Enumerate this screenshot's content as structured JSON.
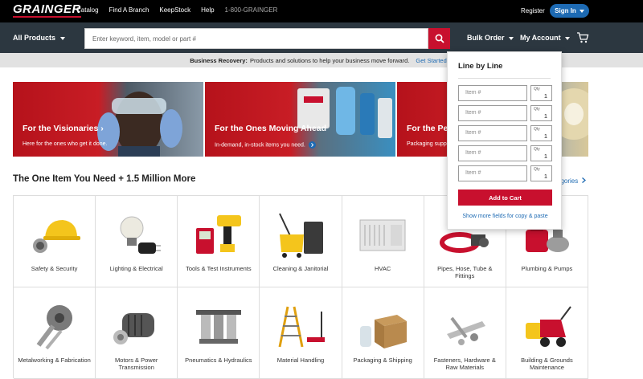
{
  "topbar": {
    "logo": "GRAINGER",
    "links": [
      "Catalog",
      "Find A Branch",
      "KeepStock",
      "Help"
    ],
    "phone": "1-800-GRAINGER",
    "register": "Register",
    "signin": "Sign In"
  },
  "navbar": {
    "all_products": "All Products",
    "search_placeholder": "Enter keyword, item, model or part #",
    "bulk_order": "Bulk Order",
    "my_account": "My Account"
  },
  "banner": {
    "bold": "Business Recovery:",
    "text": "Products and solutions to help your business move forward.",
    "link": "Get Started"
  },
  "heroes": [
    {
      "title": "For the Visionaries",
      "sub": "Here for the ones who get it done."
    },
    {
      "title": "For the Ones Moving Ahead",
      "sub": "In-demand, in-stock items you need."
    },
    {
      "title": "For the Pe",
      "sub": "Packaging supp"
    }
  ],
  "section": {
    "title": "The One Item You Need + 1.5 Million More",
    "all_categories": "egories"
  },
  "categories": [
    {
      "label": "Safety & Security",
      "icon": "hard-hat"
    },
    {
      "label": "Lighting & Electrical",
      "icon": "bulb"
    },
    {
      "label": "Tools & Test Instruments",
      "icon": "drill"
    },
    {
      "label": "Cleaning & Janitorial",
      "icon": "mop-bucket"
    },
    {
      "label": "HVAC",
      "icon": "ac-unit"
    },
    {
      "label": "Pipes, Hose, Tube & Fittings",
      "icon": "hose"
    },
    {
      "label": "Plumbing & Pumps",
      "icon": "pump"
    },
    {
      "label": "Metalworking & Fabrication",
      "icon": "cutter"
    },
    {
      "label": "Motors & Power Transmission",
      "icon": "motor"
    },
    {
      "label": "Pneumatics & Hydraulics",
      "icon": "pneumatic"
    },
    {
      "label": "Material Handling",
      "icon": "ladder"
    },
    {
      "label": "Packaging & Shipping",
      "icon": "box"
    },
    {
      "label": "Fasteners, Hardware & Raw Materials",
      "icon": "fasteners"
    },
    {
      "label": "Building & Grounds Maintenance",
      "icon": "snowblower"
    }
  ],
  "bulk_popup": {
    "title": "Line by Line",
    "item_placeholder": "Item #",
    "qty_label": "Qty",
    "rows": [
      {
        "qty": "1"
      },
      {
        "qty": "1"
      },
      {
        "qty": "1"
      },
      {
        "qty": "1"
      },
      {
        "qty": "1"
      }
    ],
    "add_to_cart": "Add to Cart",
    "show_more": "Show more fields for copy & paste"
  },
  "colors": {
    "brand_red": "#c8102e",
    "nav_dark": "#2c3740",
    "link_blue": "#1d6ab3"
  }
}
